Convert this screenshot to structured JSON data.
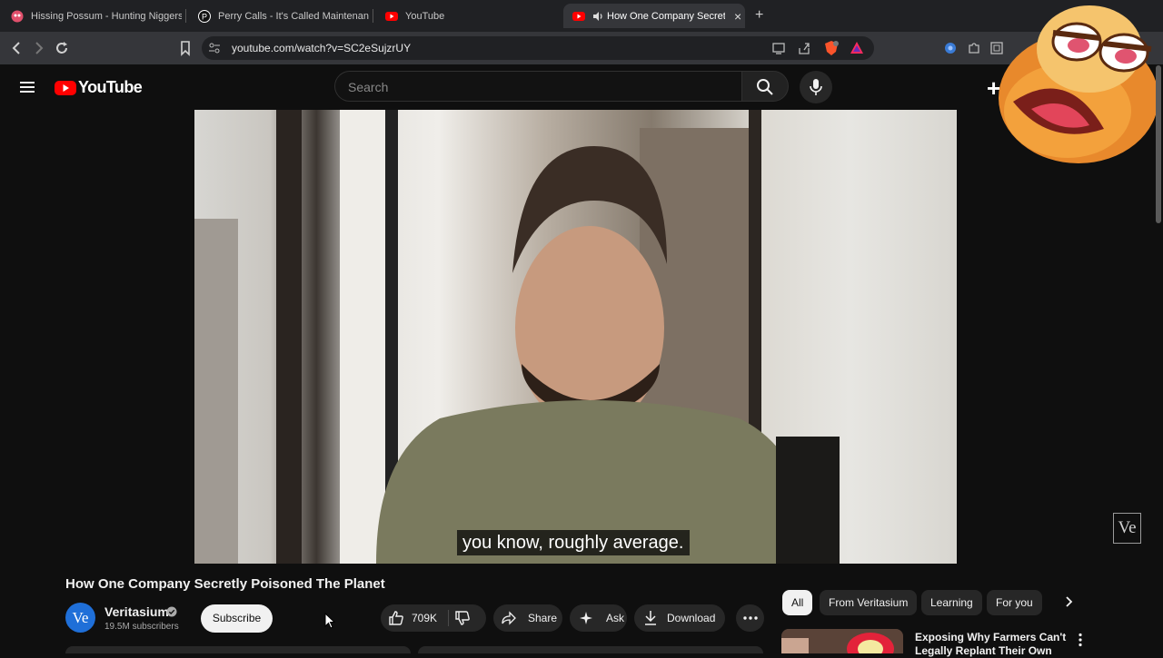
{
  "browser": {
    "tabs": [
      {
        "title": "Hissing Possum - Hunting Niggers in",
        "favicon_color": "#e0506c"
      },
      {
        "title": "Perry Calls - It's Called Maintenance |",
        "favicon_color": "#ffffff"
      },
      {
        "title": "YouTube",
        "favicon_color": "#ff0000"
      },
      {
        "title": "How One Company Secretly P",
        "favicon_color": "#ff0000",
        "active": true
      }
    ],
    "new_tab_label": "+",
    "close_label": "×",
    "url": "youtube.com/watch?v=SC2eSujzrUY"
  },
  "youtube": {
    "logo_text": "YouTube",
    "search_placeholder": "Search",
    "create_label": "+",
    "accent": "#ff0000"
  },
  "player": {
    "subtitle": "you know, roughly average.",
    "watermark": "Ve"
  },
  "video": {
    "title": "How One Company Secretly Poisoned The Planet",
    "channel_avatar": "Ve",
    "channel_name": "Veritasium",
    "subscribers": "19.5M subscribers",
    "subscribe_label": "Subscribe",
    "likes": "709K",
    "share_label": "Share",
    "ask_label": "Ask",
    "download_label": "Download"
  },
  "filters": [
    "All",
    "From Veritasium",
    "Learning",
    "For you"
  ],
  "recommendation": {
    "title_line1": "Exposing Why Farmers Can't",
    "title_line2": "Legally Replant Their Own"
  }
}
